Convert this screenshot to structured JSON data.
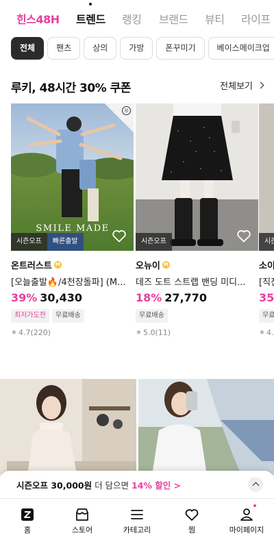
{
  "top_tabs": [
    {
      "label": "힌스48H",
      "state": "brand"
    },
    {
      "label": "트렌드",
      "state": "active"
    },
    {
      "label": "랭킹",
      "state": "inactive"
    },
    {
      "label": "브랜드",
      "state": "inactive"
    },
    {
      "label": "뷰티",
      "state": "inactive"
    },
    {
      "label": "라이프",
      "state": "inactive"
    }
  ],
  "categories": [
    {
      "label": "전체",
      "selected": true
    },
    {
      "label": "팬츠",
      "selected": false
    },
    {
      "label": "상의",
      "selected": false
    },
    {
      "label": "가방",
      "selected": false
    },
    {
      "label": "폰꾸미기",
      "selected": false
    },
    {
      "label": "베이스메이크업",
      "selected": false
    }
  ],
  "section": {
    "title": "루키, 48시간 30% 쿠폰",
    "see_all": "전체보기"
  },
  "products": [
    {
      "brand": "온트러스트",
      "brand_badge": "M",
      "name": "[오늘출발🔥/4천장돌파] (M...",
      "discount": "39%",
      "price": "30,430",
      "image_tags": [
        "시즌오프",
        "빠른출발"
      ],
      "pills": [
        {
          "label": "최저가도전",
          "style": "pink"
        },
        {
          "label": "무료배송",
          "style": "plain"
        }
      ],
      "rating": "4.7(220)",
      "image_text": "SMILE MADE"
    },
    {
      "brand": "오뉴이",
      "brand_badge": "M",
      "name": "데즈 도트 스트랩 밴딩 미디...",
      "discount": "18%",
      "price": "27,770",
      "image_tags": [
        "시즌오프"
      ],
      "pills": [
        {
          "label": "무료배송",
          "style": "plain"
        }
      ],
      "rating": "5.0(11)"
    },
    {
      "brand": "소이",
      "brand_badge": "",
      "name": "[직진",
      "discount": "35",
      "price": "",
      "image_tags": [
        "시즌"
      ],
      "pills": [
        {
          "label": "무료",
          "style": "plain"
        }
      ],
      "rating": "4."
    }
  ],
  "coupon": {
    "prefix": "시즌오프 30,000원",
    "middle": " 더 담으면 ",
    "highlight": "14% 할인 >"
  },
  "bottom_nav": [
    {
      "label": "홈",
      "icon": "home-z-icon"
    },
    {
      "label": "스토어",
      "icon": "store-icon"
    },
    {
      "label": "카테고리",
      "icon": "menu-icon"
    },
    {
      "label": "찜",
      "icon": "heart-icon"
    },
    {
      "label": "마이페이지",
      "icon": "user-icon"
    }
  ],
  "colors": {
    "accent": "#e83fa0",
    "dark_chip": "#2b2b2b",
    "tag_dark": "#282828",
    "tag_blue": "#2b4a8c"
  }
}
